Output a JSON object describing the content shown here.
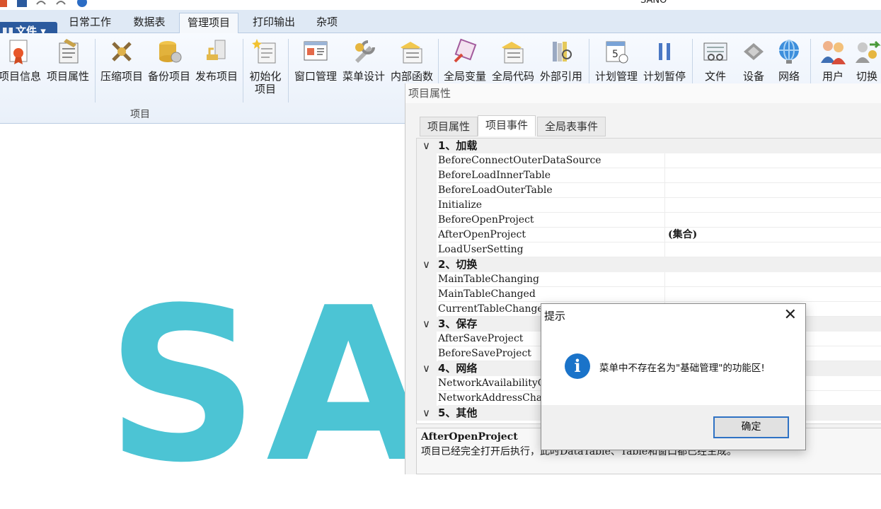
{
  "window": {
    "title": "SANO"
  },
  "file_menu": {
    "label": "文件"
  },
  "tabs": [
    {
      "label": "日常工作"
    },
    {
      "label": "数据表"
    },
    {
      "label": "管理项目"
    },
    {
      "label": "打印输出"
    },
    {
      "label": "杂项"
    }
  ],
  "ribbon": {
    "group_label": "项目",
    "buttons": [
      {
        "label": "项目信息",
        "icon": "certificate-icon"
      },
      {
        "label": "项目属性",
        "icon": "properties-icon"
      },
      {
        "label": "压缩项目",
        "icon": "compress-icon"
      },
      {
        "label": "备份项目",
        "icon": "backup-icon"
      },
      {
        "label": "发布项目",
        "icon": "publish-icon"
      },
      {
        "label": "初始化",
        "label2": "项目",
        "icon": "init-icon"
      },
      {
        "label": "窗口管理",
        "icon": "window-icon"
      },
      {
        "label": "菜单设计",
        "icon": "menu-design-icon"
      },
      {
        "label": "内部函数",
        "icon": "function-icon"
      },
      {
        "label": "全局变量",
        "icon": "variable-icon"
      },
      {
        "label": "全局代码",
        "icon": "code-icon"
      },
      {
        "label": "外部引用",
        "icon": "reference-icon"
      },
      {
        "label": "计划管理",
        "icon": "calendar-icon"
      },
      {
        "label": "计划暂停",
        "icon": "pause-icon"
      },
      {
        "label": "文件",
        "icon": "file-icon"
      },
      {
        "label": "设备",
        "icon": "device-icon"
      },
      {
        "label": "网络",
        "icon": "globe-icon"
      },
      {
        "label": "用户",
        "icon": "users-icon"
      },
      {
        "label": "切换",
        "icon": "switch-icon"
      }
    ]
  },
  "logo": {
    "text": "SA"
  },
  "properties_window": {
    "title": "项目属性",
    "tabs": [
      {
        "label": "项目属性"
      },
      {
        "label": "项目事件"
      },
      {
        "label": "全局表事件"
      }
    ],
    "categories": [
      {
        "name": "1、加载",
        "props": [
          {
            "name": "BeforeConnectOuterDataSource",
            "value": ""
          },
          {
            "name": "BeforeLoadInnerTable",
            "value": ""
          },
          {
            "name": "BeforeLoadOuterTable",
            "value": ""
          },
          {
            "name": "Initialize",
            "value": ""
          },
          {
            "name": "BeforeOpenProject",
            "value": ""
          },
          {
            "name": "AfterOpenProject",
            "value": "(集合)"
          },
          {
            "name": "LoadUserSetting",
            "value": ""
          }
        ]
      },
      {
        "name": "2、切换",
        "props": [
          {
            "name": "MainTableChanging",
            "value": ""
          },
          {
            "name": "MainTableChanged",
            "value": ""
          },
          {
            "name": "CurrentTableChanged",
            "value": ""
          }
        ]
      },
      {
        "name": "3、保存",
        "props": [
          {
            "name": "AfterSaveProject",
            "value": ""
          },
          {
            "name": "BeforeSaveProject",
            "value": ""
          }
        ]
      },
      {
        "name": "4、网络",
        "props": [
          {
            "name": "NetworkAvailabilityC",
            "value": ""
          },
          {
            "name": "NetworkAddressChange",
            "value": ""
          }
        ]
      },
      {
        "name": "5、其他",
        "props": []
      }
    ],
    "description": {
      "title": "AfterOpenProject",
      "text": "项目已经完全打开后执行，此时DataTable、Table和窗口都已经生成。"
    }
  },
  "dialog": {
    "title": "提示",
    "message": "菜单中不存在名为\"基础管理\"的功能区!",
    "ok_label": "确定",
    "close_symbol": "✕",
    "icon_symbol": "i"
  },
  "colors": {
    "accent": "#2b5a9e",
    "logo": "#4cc4d4",
    "info": "#1a73c9"
  }
}
